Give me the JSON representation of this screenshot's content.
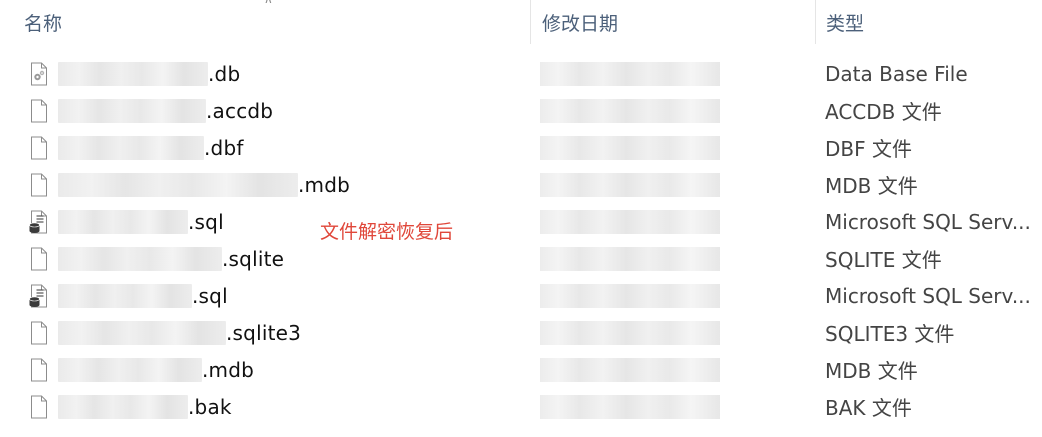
{
  "columns": {
    "name": "名称",
    "date": "修改日期",
    "type": "类型"
  },
  "annotation": "文件解密恢复后",
  "files": [
    {
      "ext": ".db",
      "type": "Data Base File",
      "icon": "db-file-icon"
    },
    {
      "ext": ".accdb",
      "type": "ACCDB 文件",
      "icon": "blank-file-icon"
    },
    {
      "ext": ".dbf",
      "type": "DBF 文件",
      "icon": "blank-file-icon"
    },
    {
      "ext": ".mdb",
      "type": "MDB 文件",
      "icon": "blank-file-icon"
    },
    {
      "ext": ".sql",
      "type": "Microsoft SQL Serv...",
      "icon": "sql-file-icon"
    },
    {
      "ext": ".sqlite",
      "type": "SQLITE 文件",
      "icon": "blank-file-icon"
    },
    {
      "ext": ".sql",
      "type": "Microsoft SQL Serv...",
      "icon": "sql-file-icon"
    },
    {
      "ext": ".sqlite3",
      "type": "SQLITE3 文件",
      "icon": "blank-file-icon"
    },
    {
      "ext": ".mdb",
      "type": "MDB 文件",
      "icon": "blank-file-icon"
    },
    {
      "ext": ".bak",
      "type": "BAK 文件",
      "icon": "blank-file-icon"
    }
  ]
}
